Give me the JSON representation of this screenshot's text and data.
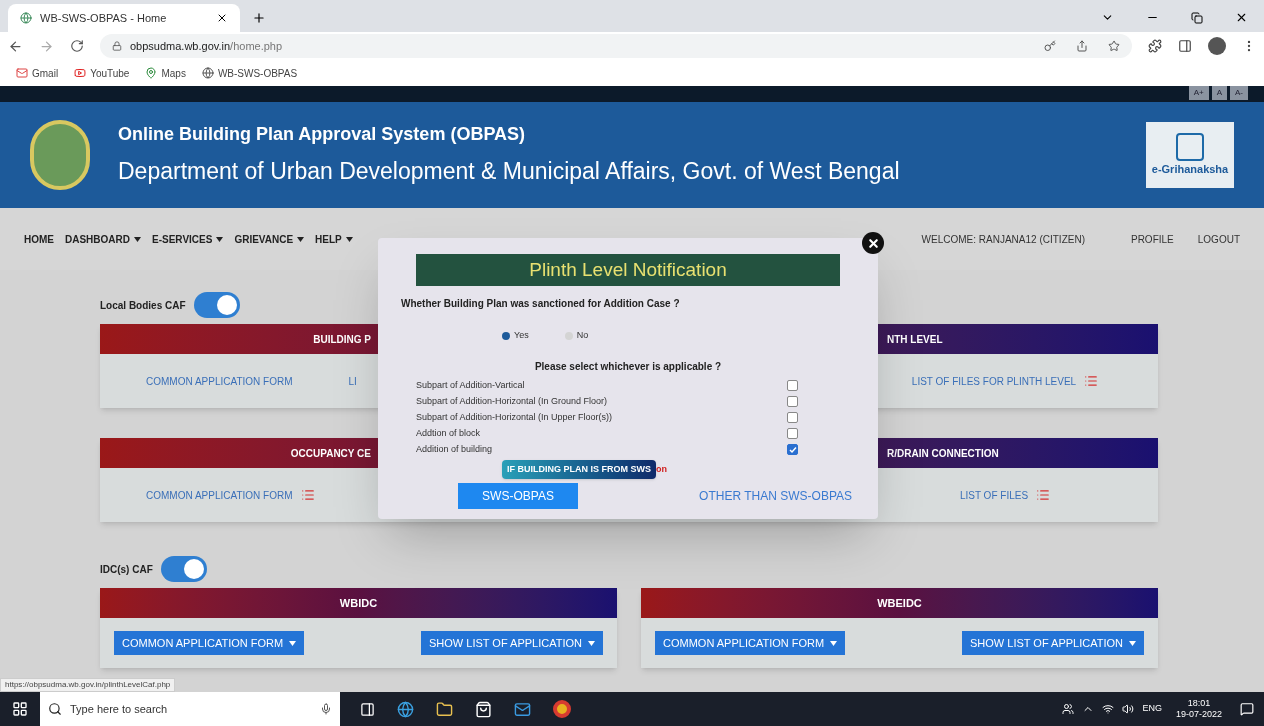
{
  "browser": {
    "tab_title": "WB-SWS-OBPAS - Home",
    "url_host": "obpsudma.wb.gov.in",
    "url_path": "/home.php",
    "bookmarks": [
      "Gmail",
      "YouTube",
      "Maps",
      "WB-SWS-OBPAS"
    ]
  },
  "font_buttons": [
    "A+",
    "A",
    "A-"
  ],
  "header": {
    "title": "Online Building Plan Approval System (OBPAS)",
    "subtitle": "Department of Urban Development & Municipal Affairs, Govt. of West Bengal",
    "logo_text": "e-Grihanaksha"
  },
  "nav": {
    "items": [
      {
        "label": "HOME",
        "dropdown": false
      },
      {
        "label": "DASHBOARD",
        "dropdown": true
      },
      {
        "label": "E-SERVICES",
        "dropdown": true
      },
      {
        "label": "GRIEVANCE",
        "dropdown": true
      },
      {
        "label": "HELP",
        "dropdown": true
      }
    ],
    "welcome": "WELCOME: RANJANA12 (CITIZEN)",
    "links": [
      "PROFILE",
      "LOGOUT"
    ]
  },
  "local_bodies": {
    "label": "Local Bodies CAF",
    "on": true,
    "cards": [
      {
        "left_title": "BUILDING P",
        "right_title": "NTH LEVEL",
        "left_links": [
          {
            "text": "COMMON APPLICATION FORM",
            "list_icon": false
          },
          {
            "text": "LI",
            "list_icon": false
          }
        ],
        "right_links": [
          {
            "text": "LIST OF FILES FOR PLINTH LEVEL",
            "list_icon": true
          }
        ]
      },
      {
        "left_title": "OCCUPANCY CE",
        "right_title": "R/DRAIN CONNECTION",
        "left_links": [
          {
            "text": "COMMON APPLICATION FORM",
            "list_icon": true
          }
        ],
        "right_links": [
          {
            "text": "LIST OF FILES",
            "list_icon": true
          }
        ]
      }
    ]
  },
  "idc": {
    "label": "IDC(s) CAF",
    "on": true,
    "cards": [
      {
        "title": "WBIDC",
        "buttons": [
          "COMMON APPLICATION FORM",
          "SHOW LIST OF APPLICATION"
        ]
      },
      {
        "title": "WBEIDC",
        "buttons": [
          "COMMON APPLICATION FORM",
          "SHOW LIST OF APPLICATION"
        ]
      }
    ]
  },
  "modal": {
    "title": "Plinth Level Notification",
    "question": "Whether Building Plan was sanctioned for Addition Case ?",
    "radios": [
      {
        "label": "Yes",
        "selected": true
      },
      {
        "label": "No",
        "selected": false
      }
    ],
    "prompt": "Please select whichever is applicable ?",
    "options": [
      {
        "label": "Subpart of Addition-Vartical",
        "checked": false
      },
      {
        "label": "Subpart of Addition-Horizontal (In Ground Floor)",
        "checked": false
      },
      {
        "label": "Subpart of Addition-Horizontal (In Upper Floor(s))",
        "checked": false
      },
      {
        "label": "Addtion of block",
        "checked": false
      },
      {
        "label": "Addition of building",
        "checked": true
      }
    ],
    "tooltip": "IF BUILDING PLAN IS FROM SWS",
    "note_tail": "on",
    "primary_button": "SWS-OBPAS",
    "secondary_button": "OTHER THAN SWS-OBPAS"
  },
  "status_url": "https://obpsudma.wb.gov.in/plinthLevelCaf.php",
  "taskbar": {
    "search_placeholder": "Type here to search",
    "language": "ENG",
    "time": "18:01",
    "date": "19-07-2022"
  }
}
